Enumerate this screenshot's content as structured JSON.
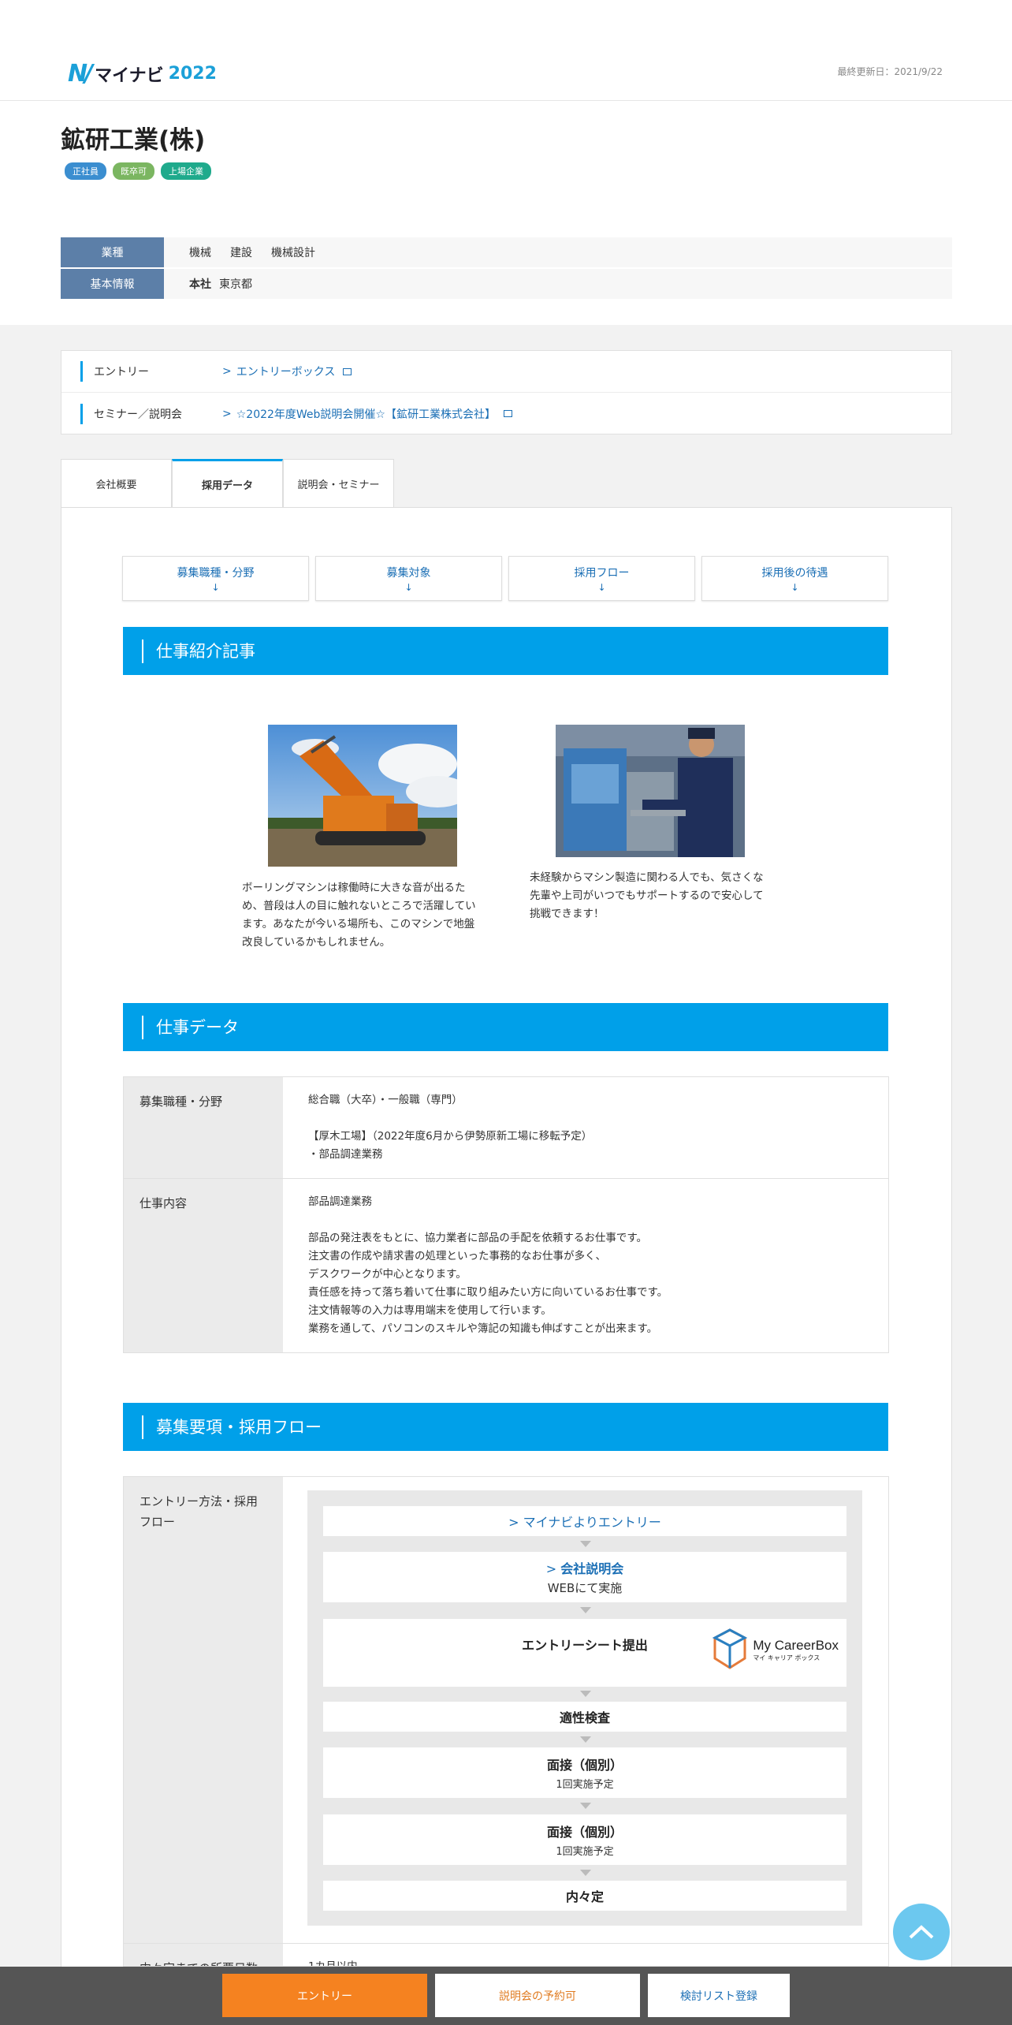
{
  "brand": {
    "mark": "N/",
    "name": "マイナビ",
    "year": "2022"
  },
  "updated": "最終更新日：2021/9/22",
  "company": {
    "name": "鉱研工業(株)",
    "tags": [
      "正社員",
      "既卒可",
      "上場企業"
    ]
  },
  "info": {
    "industry_label": "業種",
    "industries": [
      "機械",
      "建設",
      "機械設計"
    ],
    "basic_label": "基本情報",
    "hq_label": "本社",
    "hq": "東京都"
  },
  "links": [
    {
      "label": "エントリー",
      "text": "エントリーボックス"
    },
    {
      "label": "セミナー／説明会",
      "text": "☆2022年度Web説明会開催☆【鉱研工業株式会社】"
    }
  ],
  "tabs": [
    "会社概要",
    "採用データ",
    "説明会・セミナー"
  ],
  "subnav": [
    "募集職種・分野",
    "募集対象",
    "採用フロー",
    "採用後の待遇"
  ],
  "subnav_arrow": "↓",
  "section1": "仕事紹介記事",
  "articles": [
    {
      "caption": "ボーリングマシンは稼働時に大きな音が出るため、普段は人の目に触れないところで活躍しています。あなたが今いる場所も、このマシンで地盤改良しているかもしれません。"
    },
    {
      "caption": "未経験からマシン製造に関わる人でも、気さくな先輩や上司がいつでもサポートするので安心して挑戦できます！"
    }
  ],
  "section2": "仕事データ",
  "jobdata": [
    {
      "th": "募集職種・分野",
      "lines": [
        "総合職（大卒）・一般職（専門）",
        "",
        "【厚木工場】（2022年度6月から伊勢原新工場に移転予定）",
        "・部品調達業務"
      ]
    },
    {
      "th": "仕事内容",
      "lines": [
        "部品調達業務",
        "",
        "部品の発注表をもとに、協力業者に部品の手配を依頼するお仕事です。",
        "注文書の作成や請求書の処理といった事務的なお仕事が多く、",
        "デスクワークが中心となります。",
        "責任感を持って落ち着いて仕事に取り組みたい方に向いているお仕事です。",
        "注文情報等の入力は専用端末を使用して行います。",
        "業務を通して、パソコンのスキルや簿記の知識も伸ばすことが出来ます。"
      ]
    }
  ],
  "section3": "募集要項・採用フロー",
  "flow_th": "エントリー方法・採用フロー",
  "flow": {
    "s1": "マイナビよりエントリー",
    "s2": "会社説明会",
    "s2sub": "WEBにて実施",
    "s3": "エントリーシート提出",
    "s3logo": "My CareerBox",
    "s3logo_sub": "マイ キャリア ボックス",
    "s4": "適性検査",
    "s5": "面接（個別）",
    "s5sub": "1回実施予定",
    "s6": "面接（個別）",
    "s6sub": "1回実施予定",
    "s7": "内々定"
  },
  "next_row": {
    "th": "内々定までの所要日数",
    "td": "1カ月以内"
  },
  "bottom": {
    "entry": "エントリー",
    "seminar": "説明会の予約可",
    "list": "検討リスト登録"
  },
  "colors": {
    "accent": "#00a0e9",
    "entry": "#f58220",
    "nav_label": "#5c7fa8"
  }
}
